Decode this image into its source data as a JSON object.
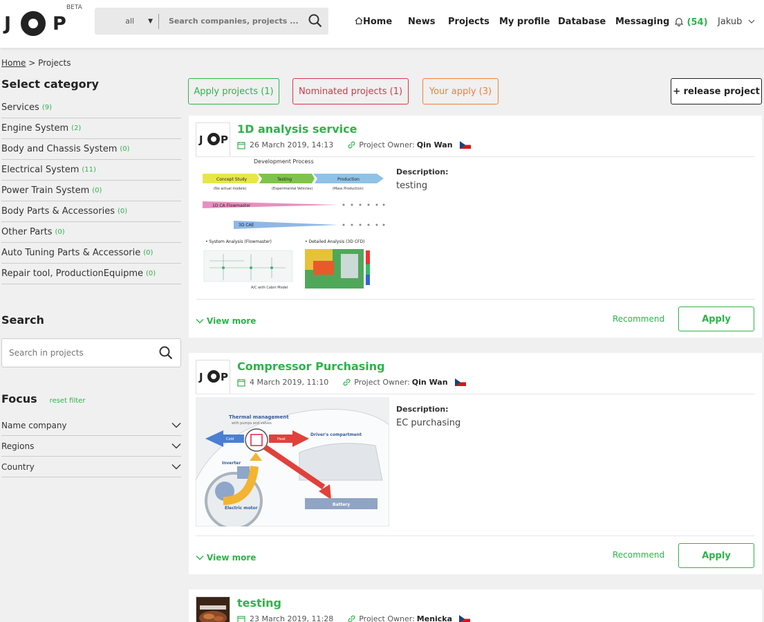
{
  "header": {
    "logo_text_left": "J",
    "logo_text_right": "P",
    "logo_badge": "BETA",
    "search": {
      "scope_value": "all",
      "placeholder": "Search companies, projects ..."
    },
    "nav": {
      "home": "Home",
      "news": "News",
      "projects": "Projects",
      "my_profile": "My profile",
      "database": "Database",
      "messaging": "Messaging",
      "notifications": "(54)",
      "user": "Jakub"
    }
  },
  "breadcrumb": {
    "home": "Home",
    "separator": ">",
    "current": "Projects"
  },
  "sidebar": {
    "category_title": "Select category",
    "categories": [
      {
        "label": "Services",
        "count": "(9)"
      },
      {
        "label": "Engine System",
        "count": "(2)"
      },
      {
        "label": "Body and Chassis System",
        "count": "(0)"
      },
      {
        "label": "Electrical System",
        "count": "(11)"
      },
      {
        "label": "Power Train System",
        "count": "(0)"
      },
      {
        "label": "Body Parts & Accessories",
        "count": "(0)"
      },
      {
        "label": "Other Parts",
        "count": "(0)"
      },
      {
        "label": "Auto Tuning Parts & Accessorie",
        "count": "(0)"
      },
      {
        "label": "Repair tool, ProductionEquipme",
        "count": "(0)"
      }
    ],
    "search_title": "Search",
    "search_placeholder": "Search in projects",
    "focus_title": "Focus",
    "reset_filter": "reset filter",
    "filters": [
      {
        "label": "Name company"
      },
      {
        "label": "Regions"
      },
      {
        "label": "Country"
      }
    ]
  },
  "tabs": {
    "apply": "Apply projects (1)",
    "nominated": "Nominated projects (1)",
    "your_apply": "Your apply (3)",
    "release": "+ release project"
  },
  "projects": [
    {
      "title": "1D analysis service",
      "date": "26 March 2019, 14:13",
      "owner_label": "Project Owner:",
      "owner": "Qin Wan",
      "description_label": "Description:",
      "description": "testing",
      "view_more": "View more",
      "recommend": "Recommend",
      "apply": "Apply",
      "image": {
        "heading": "Development Process",
        "stages": [
          "Concept Study",
          "Testing",
          "Production"
        ],
        "stage_notes": [
          "(No actual models)",
          "(Experimental Vehicles)",
          "(Mass Production)"
        ],
        "bars": [
          "1D CA Flowmaster",
          "3D CAE"
        ],
        "panels": [
          "• System Analysis (Flowmaster)",
          "• Detailed Analysis (3D CFD)"
        ],
        "caption": "A/C with Cabin Model"
      }
    },
    {
      "title": "Compressor Purchasing",
      "date": "4 March 2019, 11:10",
      "owner_label": "Project Owner:",
      "owner": "Qin Wan",
      "description_label": "Description:",
      "description": "EC purchasing",
      "view_more": "View more",
      "recommend": "Recommend",
      "apply": "Apply",
      "image": {
        "title": "Thermal management",
        "subtitle": "with pumps and valves",
        "labels": [
          "Driver's compartment",
          "Inverter",
          "Electric motor",
          "Battery",
          "Cold",
          "Heat"
        ]
      }
    },
    {
      "title": "testing",
      "date": "23 March 2019, 11:28",
      "owner_label": "Project Owner:",
      "owner": "Menicka"
    }
  ]
}
